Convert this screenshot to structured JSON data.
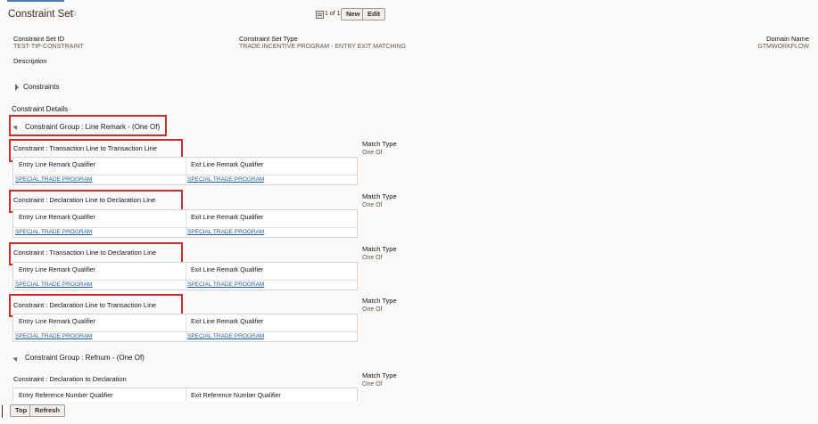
{
  "page": {
    "title": "Constraint Set"
  },
  "pager": {
    "text": "1 of 1"
  },
  "buttons": {
    "new": "New",
    "edit": "Edit",
    "top": "Top",
    "refresh": "Refresh"
  },
  "fields": {
    "set_id_label": "Constraint Set ID",
    "set_id_value": "TEST-TIP-CONSTRAINT",
    "set_type_label": "Constraint Set Type",
    "set_type_value": "TRADE INCENTIVE PROGRAM - ENTRY EXIT MATCHING",
    "domain_label": "Domain Name",
    "domain_value": "GTMWORKFLOW",
    "description_label": "Description"
  },
  "constraints_section": "Constraints",
  "details_label": "Constraint Details",
  "groups": [
    {
      "title": "Constraint Group : Line Remark - (One Of)",
      "constraints": [
        {
          "title": "Constraint : Transaction Line to Transaction Line",
          "col1": "Entry Line Remark Qualifier",
          "col2": "Exit Line Remark Qualifier",
          "val1": "SPECIAL TRADE PROGRAM",
          "val2": "SPECIAL TRADE PROGRAM",
          "match_label": "Match Type",
          "match_value": "One Of"
        },
        {
          "title": "Constraint : Declaration Line to Declaration Line",
          "col1": "Entry Line Remark Qualifier",
          "col2": "Exit Line Remark Qualifier",
          "val1": "SPECIAL TRADE PROGRAM",
          "val2": "SPECIAL TRADE PROGRAM",
          "match_label": "Match Type",
          "match_value": "One Of"
        },
        {
          "title": "Constraint : Transaction Line to Declaration Line",
          "col1": "Entry Line Remark Qualifier",
          "col2": "Exit Line Remark Qualifier",
          "val1": "SPECIAL TRADE PROGRAM",
          "val2": "SPECIAL TRADE PROGRAM",
          "match_label": "Match Type",
          "match_value": "One Of"
        },
        {
          "title": "Constraint : Declaration Line to Transaction Line",
          "col1": "Entry Line Remark Qualifier",
          "col2": "Exit Line Remark Qualifier",
          "val1": "SPECIAL TRADE PROGRAM",
          "val2": "SPECIAL TRADE PROGRAM",
          "match_label": "Match Type",
          "match_value": "One Of"
        }
      ]
    },
    {
      "title": "Constraint Group : Refnum - (One Of)",
      "constraints": [
        {
          "title": "Constraint : Declaration to Declaration",
          "col1": "Entry Reference Number Qualifier",
          "col2": "Exit Reference Number Qualifier",
          "match_label": "Match Type",
          "match_value": "One Of"
        }
      ]
    }
  ],
  "icons": {
    "favorite": "star-outline-icon",
    "pager": "record-list-icon",
    "expand": "triangle-right-icon",
    "collapse": "triangle-down-icon"
  },
  "colors": {
    "highlight": "#c9302c",
    "link": "#1d5d9b",
    "background": "#fbf9f8"
  }
}
